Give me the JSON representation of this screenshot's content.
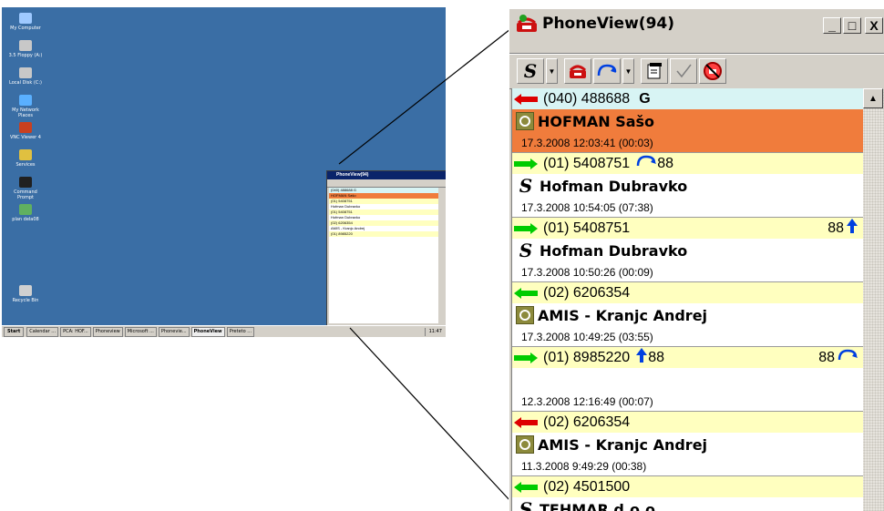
{
  "desktop": {
    "icons": [
      "My Computer",
      "3.5 Floppy (A:)",
      "Local Disk (C:)",
      "My Network Places",
      "VNC Viewer 4",
      "Services",
      "Command Prompt",
      "plan dela08",
      "Recycle Bin"
    ],
    "taskbar": {
      "start": "Start",
      "items": [
        "Calendar ...",
        "PCA: HOF...",
        "Phoneview",
        "Microsoft ...",
        "Phonevie...",
        "PhoneView",
        "Preteto ..."
      ],
      "active_index": 5,
      "clock": "11:47"
    },
    "thumb_title": "PhoneView(94)"
  },
  "window": {
    "title": "PhoneView(94)",
    "controls": {
      "minimize": "_",
      "maximize": "□",
      "close": "X"
    }
  },
  "toolbar": {
    "icons": [
      "skype-dial-icon",
      "phone-icon",
      "transfer-icon",
      "properties-icon",
      "checkmark-icon",
      "block-icon"
    ]
  },
  "colors": {
    "header_bg": "#ffffbf",
    "header_first_bg": "#d8f4f4",
    "selected_bg": "#f07c3c",
    "arrow_in": "#00cc00",
    "arrow_out": "#dd0000",
    "blue": "#0040e0"
  },
  "calls": [
    {
      "direction": "in-red",
      "number": "(040) 488688",
      "tag": "G",
      "name": "HOFMAN Sašo",
      "datetime": "17.3.2008 12:03:41 (00:03)",
      "icon": "clock-icon",
      "selected": true,
      "header_bg": "header_first_bg"
    },
    {
      "direction": "out-green",
      "number": "(01) 5408751",
      "ext": "88",
      "ext_icon": "redirect-icon",
      "name": "Hofman Dubravko",
      "datetime": "17.3.2008 10:54:05 (07:38)",
      "icon": "skype-icon"
    },
    {
      "direction": "out-green",
      "number": "(01) 5408751",
      "right": "88",
      "right_icon": "up-arrow-icon",
      "name": "Hofman Dubravko",
      "datetime": "17.3.2008 10:50:26 (00:09)",
      "icon": "skype-icon"
    },
    {
      "direction": "in-green",
      "number": "(02) 6206354",
      "name": "AMIS - Kranjc Andrej",
      "datetime": "17.3.2008 10:49:25 (03:55)",
      "icon": "clock-icon"
    },
    {
      "direction": "out-green",
      "number": "(01) 8985220",
      "ext": "88",
      "ext_icon": "up-arrow-icon",
      "right": "88",
      "right_icon": "redirect-icon",
      "name": "",
      "datetime": "12.3.2008 12:16:49 (00:07)",
      "icon": ""
    },
    {
      "direction": "in-red",
      "number": "(02) 6206354",
      "name": "AMIS - Kranjc Andrej",
      "datetime": "11.3.2008 9:49:29 (00:38)",
      "icon": "clock-icon"
    },
    {
      "direction": "in-green",
      "number": "(02) 4501500",
      "name": "TEHMAR d.o.o.",
      "datetime": "",
      "icon": "skype-icon"
    }
  ]
}
